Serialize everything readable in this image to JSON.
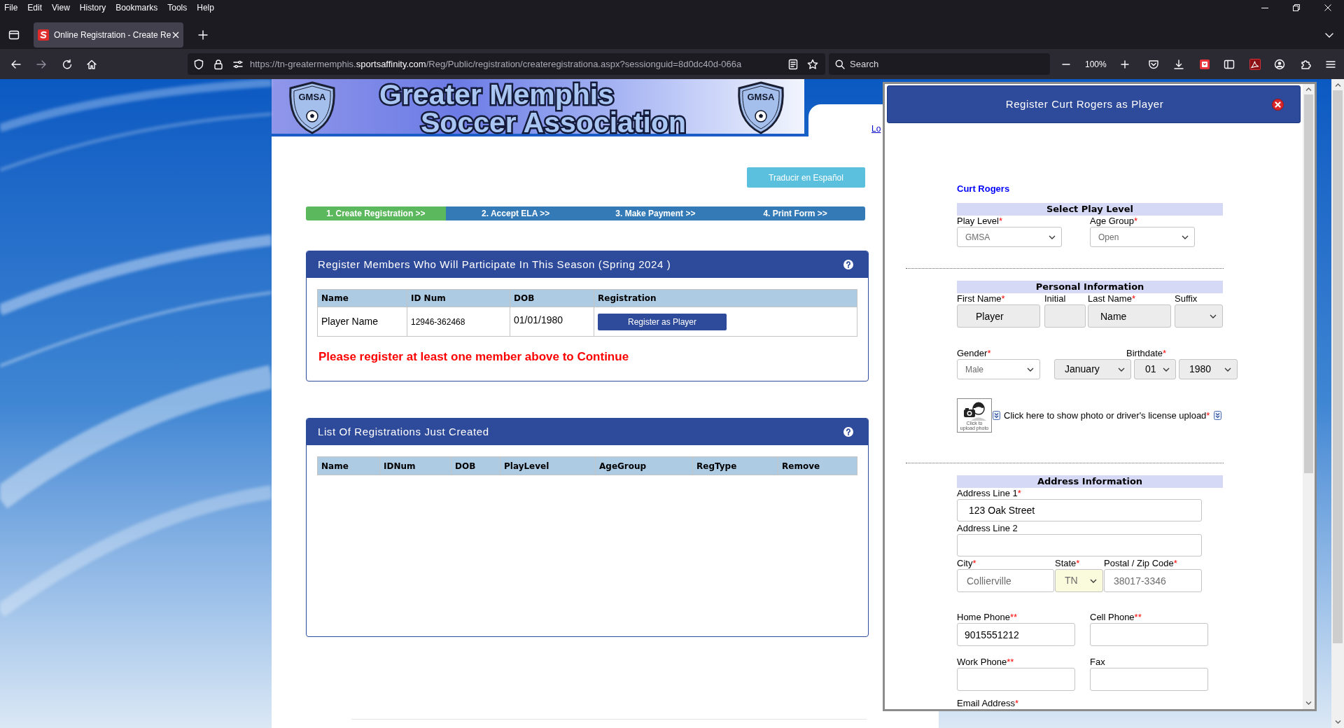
{
  "browser": {
    "menu": [
      "File",
      "Edit",
      "View",
      "History",
      "Bookmarks",
      "Tools",
      "Help"
    ],
    "tab": {
      "title": "Online Registration - Create Re"
    },
    "address_bar": {
      "url_parts": [
        {
          "text": "https://tn-greatermemphis.",
          "highlight": false
        },
        {
          "text": "sportsaffinity.com",
          "highlight": true
        },
        {
          "text": "/Reg/Public/registration/createregistrationa.aspx?sessionguid=8d0dc40d-066a",
          "highlight": false
        }
      ]
    },
    "search": {
      "placeholder": "Search"
    },
    "zoom_level": "100%"
  },
  "page": {
    "banner": {
      "left_logo": "GMSA",
      "title_lines": [
        "Greater Memphis",
        "Soccer Association"
      ],
      "right_logo": "GMSA"
    },
    "corner_link": "Lo",
    "translate_button": "Traducir en Español",
    "steps": [
      {
        "label": "1. Create Registration >>",
        "selected": true
      },
      {
        "label": "2. Accept ELA >>",
        "selected": false
      },
      {
        "label": "3. Make Payment >>",
        "selected": false
      },
      {
        "label": "4. Print Form >>",
        "selected": false
      }
    ],
    "members_panel": {
      "title": "Register Members Who Will Participate In This Season (Spring 2024 )",
      "columns": [
        "Name",
        "ID Num",
        "DOB",
        "Registration"
      ],
      "rows": [
        {
          "name": "Player Name",
          "id_num": "12946-362468",
          "dob": "01/01/1980",
          "action": "Register as Player"
        }
      ],
      "message": "Please register at least one member above to Continue"
    },
    "registrations_panel": {
      "title": "List Of Registrations Just Created",
      "columns": [
        "Name",
        "IDNum",
        "DOB",
        "PlayLevel",
        "AgeGroup",
        "RegType",
        "Remove"
      ]
    }
  },
  "modal": {
    "title": "Register Curt Rogers as Player",
    "member_name": "Curt Rogers",
    "sections": [
      {
        "heading": "Select Play Level",
        "fields": [
          {
            "label": "Play Level",
            "required": "*",
            "kind": "select",
            "value": "GMSA",
            "disabled": true,
            "readonly": false,
            "highlighted": false
          },
          {
            "label": "Age Group",
            "required": "*",
            "kind": "select",
            "value": "Open",
            "disabled": true,
            "readonly": false,
            "highlighted": false
          }
        ]
      },
      {
        "heading": "Personal Information",
        "fields": [
          {
            "label": "First Name",
            "required": "*",
            "kind": "text",
            "value": "Player",
            "disabled": false,
            "readonly": true,
            "highlighted": false
          },
          {
            "label": "Initial",
            "kind": "text",
            "readonly": true,
            "highlighted": false
          },
          {
            "label": "Last Name",
            "required": "*",
            "kind": "text",
            "value": "Name",
            "disabled": false,
            "readonly": true,
            "highlighted": false
          },
          {
            "label": "Suffix",
            "kind": "select",
            "readonly": true,
            "highlighted": false
          },
          {
            "label": "Gender",
            "required": "*",
            "kind": "select",
            "value": "Male",
            "disabled": true,
            "readonly": false,
            "highlighted": false
          },
          {
            "label": "Birthdate",
            "required": "*",
            "kind": "date",
            "values": [
              "January",
              "01",
              "1980"
            ],
            "disabled": false,
            "readonly": true,
            "highlighted": false
          }
        ],
        "upload": {
          "caption": "Click to upload photo",
          "text": "Click here to show photo or driver's license upload",
          "required": "*"
        }
      },
      {
        "heading": "Address Information",
        "fields": [
          {
            "label": "Address Line 1",
            "required": "*",
            "kind": "text",
            "value": "123 Oak Street",
            "disabled": false,
            "readonly": false,
            "highlighted": false
          },
          {
            "label": "Address Line 2",
            "kind": "text",
            "readonly": false,
            "highlighted": false
          },
          {
            "label": "City",
            "required": "*",
            "kind": "text",
            "value": "Collierville",
            "disabled": true,
            "readonly": false,
            "highlighted": false
          },
          {
            "label": "State",
            "required": "*",
            "kind": "select",
            "value": "TN",
            "disabled": true,
            "readonly": false,
            "highlighted": true
          },
          {
            "label": "Postal / Zip Code",
            "required": "*",
            "kind": "text",
            "value": "38017-3346",
            "disabled": true,
            "readonly": false,
            "highlighted": false
          },
          {
            "label": "Home Phone",
            "required": "**",
            "kind": "text",
            "value": "9015551212",
            "disabled": false,
            "readonly": false,
            "highlighted": false
          },
          {
            "label": "Cell Phone",
            "required": "**",
            "kind": "text",
            "readonly": false,
            "highlighted": false
          },
          {
            "label": "Work Phone",
            "required": "**",
            "kind": "text",
            "readonly": false,
            "highlighted": false
          },
          {
            "label": "Fax",
            "kind": "text",
            "readonly": false,
            "highlighted": false
          },
          {
            "label": "Email Address",
            "required": "*",
            "kind": "label"
          }
        ]
      }
    ]
  }
}
